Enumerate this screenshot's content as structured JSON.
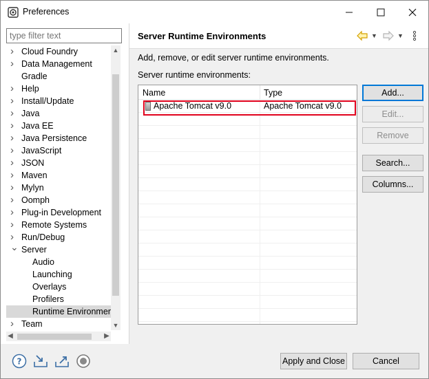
{
  "window": {
    "title": "Preferences",
    "minimize": "—",
    "maximize": "☐",
    "close": "✕"
  },
  "filter": {
    "placeholder": "type filter text"
  },
  "tree": {
    "items": [
      {
        "label": "Cloud Foundry",
        "expandable": true,
        "level": 0
      },
      {
        "label": "Data Management",
        "expandable": true,
        "level": 0
      },
      {
        "label": "Gradle",
        "expandable": false,
        "level": 0
      },
      {
        "label": "Help",
        "expandable": true,
        "level": 0
      },
      {
        "label": "Install/Update",
        "expandable": true,
        "level": 0
      },
      {
        "label": "Java",
        "expandable": true,
        "level": 0
      },
      {
        "label": "Java EE",
        "expandable": true,
        "level": 0
      },
      {
        "label": "Java Persistence",
        "expandable": true,
        "level": 0
      },
      {
        "label": "JavaScript",
        "expandable": true,
        "level": 0
      },
      {
        "label": "JSON",
        "expandable": true,
        "level": 0
      },
      {
        "label": "Maven",
        "expandable": true,
        "level": 0
      },
      {
        "label": "Mylyn",
        "expandable": true,
        "level": 0
      },
      {
        "label": "Oomph",
        "expandable": true,
        "level": 0
      },
      {
        "label": "Plug-in Development",
        "expandable": true,
        "level": 0
      },
      {
        "label": "Remote Systems",
        "expandable": true,
        "level": 0
      },
      {
        "label": "Run/Debug",
        "expandable": true,
        "level": 0
      },
      {
        "label": "Server",
        "expandable": true,
        "expanded": true,
        "level": 0
      },
      {
        "label": "Audio",
        "expandable": false,
        "level": 1
      },
      {
        "label": "Launching",
        "expandable": false,
        "level": 1
      },
      {
        "label": "Overlays",
        "expandable": false,
        "level": 1
      },
      {
        "label": "Profilers",
        "expandable": false,
        "level": 1
      },
      {
        "label": "Runtime Environmen",
        "expandable": false,
        "level": 1,
        "selected": true
      },
      {
        "label": "Team",
        "expandable": true,
        "level": 0
      }
    ]
  },
  "page": {
    "title": "Server Runtime Environments",
    "description": "Add, remove, or edit server runtime environments.",
    "list_label": "Server runtime environments:",
    "columns": [
      "Name",
      "Type"
    ],
    "rows": [
      {
        "name": "Apache Tomcat v9.0",
        "type": "Apache Tomcat v9.0",
        "checked": false
      }
    ],
    "buttons": {
      "add": "Add...",
      "edit": "Edit...",
      "remove": "Remove",
      "search": "Search...",
      "columns": "Columns..."
    }
  },
  "icons": {
    "back": "back-arrow-icon",
    "forward": "forward-arrow-icon",
    "menu": "view-menu-icon",
    "help": "help-icon",
    "import": "import-icon",
    "export": "export-icon",
    "record": "record-icon"
  },
  "footer": {
    "apply_close": "Apply and Close",
    "cancel": "Cancel"
  },
  "colors": {
    "highlight": "#e0001b",
    "primary_border": "#0078d7",
    "back_arrow": "#e8b600"
  }
}
